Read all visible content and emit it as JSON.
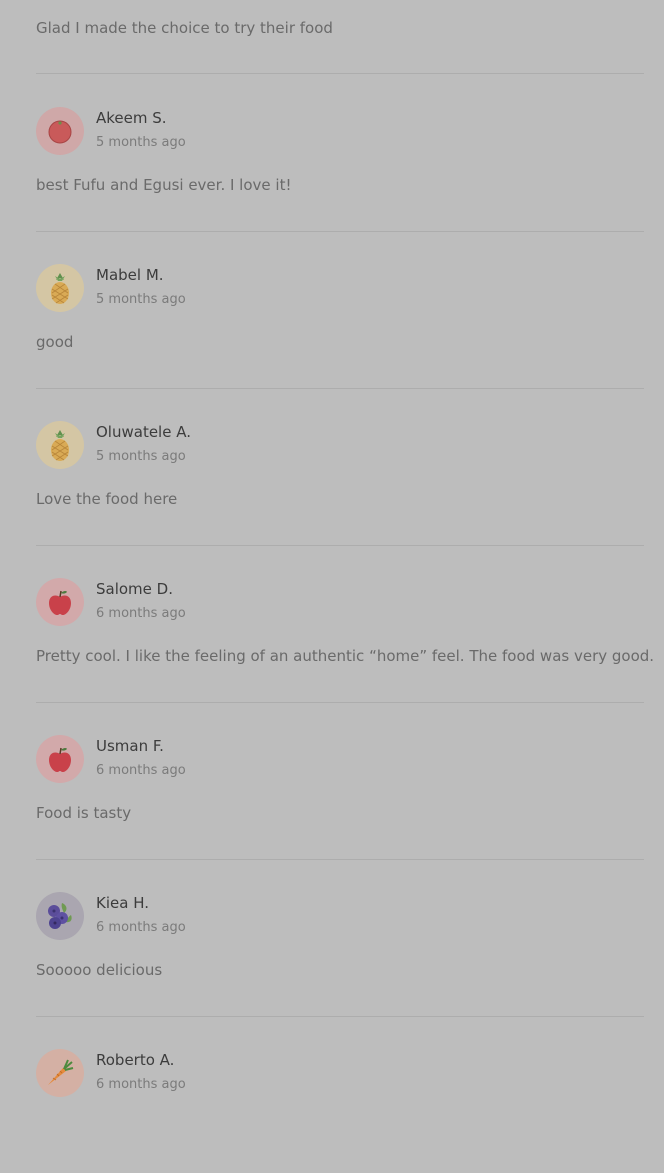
{
  "partial_review": {
    "comment": "Glad I made the choice to try their food"
  },
  "reviews": [
    {
      "name": "Akeem S.",
      "time": "5 months ago",
      "comment": "best Fufu and Egusi ever. I love it!",
      "avatar_icon": "tomato-icon",
      "avatar_bg": "#cfa8a8"
    },
    {
      "name": "Mabel M.",
      "time": "5 months ago",
      "comment": "good",
      "avatar_icon": "pineapple-icon",
      "avatar_bg": "#d4c6a4"
    },
    {
      "name": "Oluwatele A.",
      "time": "5 months ago",
      "comment": "Love the food here",
      "avatar_icon": "pineapple-icon",
      "avatar_bg": "#d4c6a4"
    },
    {
      "name": "Salome D.",
      "time": "6 months ago",
      "comment": "Pretty cool. I like the feeling of an authentic “home” feel. The food was very good.",
      "avatar_icon": "apple-icon",
      "avatar_bg": "#d2a9aa"
    },
    {
      "name": "Usman F.",
      "time": "6 months ago",
      "comment": "Food is tasty",
      "avatar_icon": "apple-icon",
      "avatar_bg": "#d2a9aa"
    },
    {
      "name": "Kiea H.",
      "time": "6 months ago",
      "comment": "Sooooo delicious",
      "avatar_icon": "blueberry-icon",
      "avatar_bg": "#aaa6b0"
    },
    {
      "name": "Roberto A.",
      "time": "6 months ago",
      "comment": "",
      "avatar_icon": "carrot-icon",
      "avatar_bg": "#d4b0a4"
    }
  ]
}
